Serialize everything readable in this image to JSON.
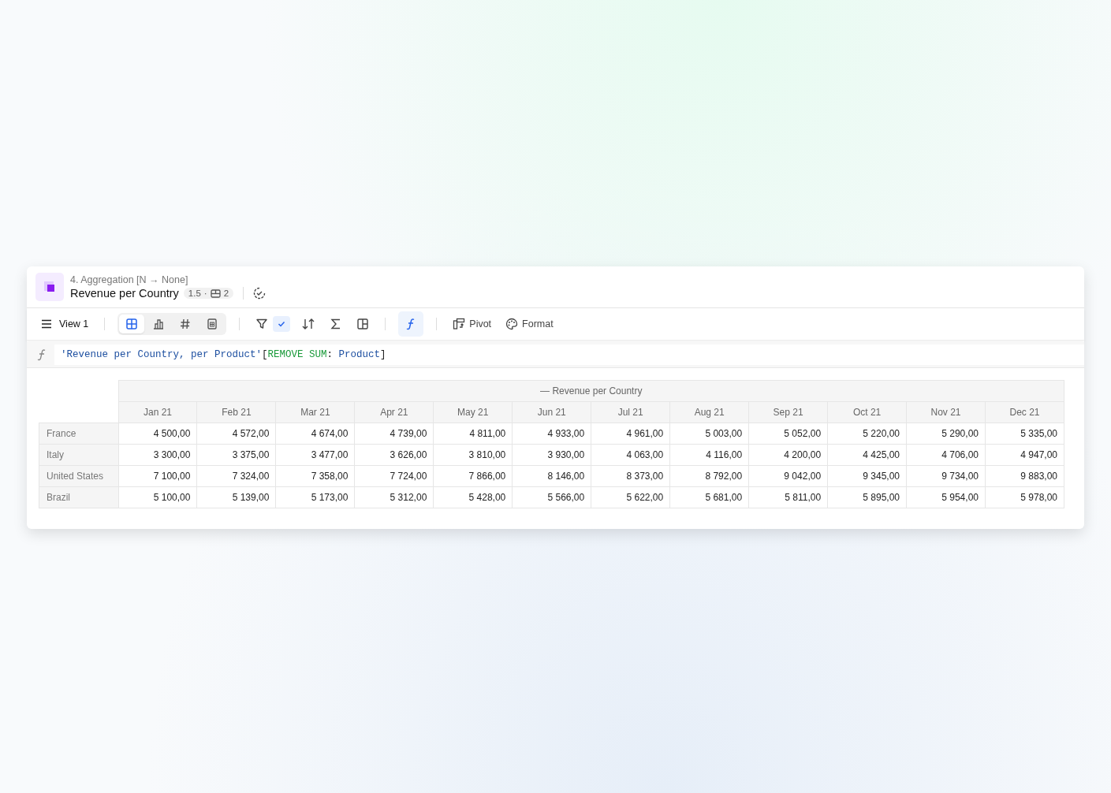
{
  "header": {
    "breadcrumb": "4. Aggregation [N → None]",
    "title": "Revenue per Country",
    "version": "1.5",
    "separator": "·",
    "table_count": "2"
  },
  "toolbar": {
    "view_label": "View 1",
    "view_modes": [
      {
        "kind": "table",
        "selected": true
      },
      {
        "kind": "chart",
        "selected": false
      },
      {
        "kind": "number",
        "selected": false
      },
      {
        "kind": "sheet",
        "selected": false
      }
    ],
    "filter_enabled": true,
    "formula_active": true,
    "pivot_label": "Pivot",
    "format_label": "Format"
  },
  "formula": {
    "tokens": [
      {
        "kind": "string",
        "text": "'Revenue per Country, per Product'"
      },
      {
        "kind": "punct",
        "text": "["
      },
      {
        "kind": "keyword",
        "text": "REMOVE SUM"
      },
      {
        "kind": "punct",
        "text": ":"
      },
      {
        "kind": "string",
        "text": " Product"
      },
      {
        "kind": "punct",
        "text": "]"
      }
    ]
  },
  "table": {
    "group_header": "— Revenue per Country",
    "columns": [
      "Jan 21",
      "Feb 21",
      "Mar 21",
      "Apr 21",
      "May 21",
      "Jun 21",
      "Jul 21",
      "Aug 21",
      "Sep 21",
      "Oct 21",
      "Nov 21",
      "Dec 21"
    ],
    "rows": [
      {
        "label": "France",
        "values": [
          "4 500,00",
          "4 572,00",
          "4 674,00",
          "4 739,00",
          "4 811,00",
          "4 933,00",
          "4 961,00",
          "5 003,00",
          "5 052,00",
          "5 220,00",
          "5 290,00",
          "5 335,00"
        ]
      },
      {
        "label": "Italy",
        "values": [
          "3 300,00",
          "3 375,00",
          "3 477,00",
          "3 626,00",
          "3 810,00",
          "3 930,00",
          "4 063,00",
          "4 116,00",
          "4 200,00",
          "4 425,00",
          "4 706,00",
          "4 947,00"
        ]
      },
      {
        "label": "United States",
        "values": [
          "7 100,00",
          "7 324,00",
          "7 358,00",
          "7 724,00",
          "7 866,00",
          "8 146,00",
          "8 373,00",
          "8 792,00",
          "9 042,00",
          "9 345,00",
          "9 734,00",
          "9 883,00"
        ]
      },
      {
        "label": "Brazil",
        "values": [
          "5 100,00",
          "5 139,00",
          "5 173,00",
          "5 312,00",
          "5 428,00",
          "5 566,00",
          "5 622,00",
          "5 681,00",
          "5 811,00",
          "5 895,00",
          "5 954,00",
          "5 978,00"
        ]
      }
    ]
  }
}
